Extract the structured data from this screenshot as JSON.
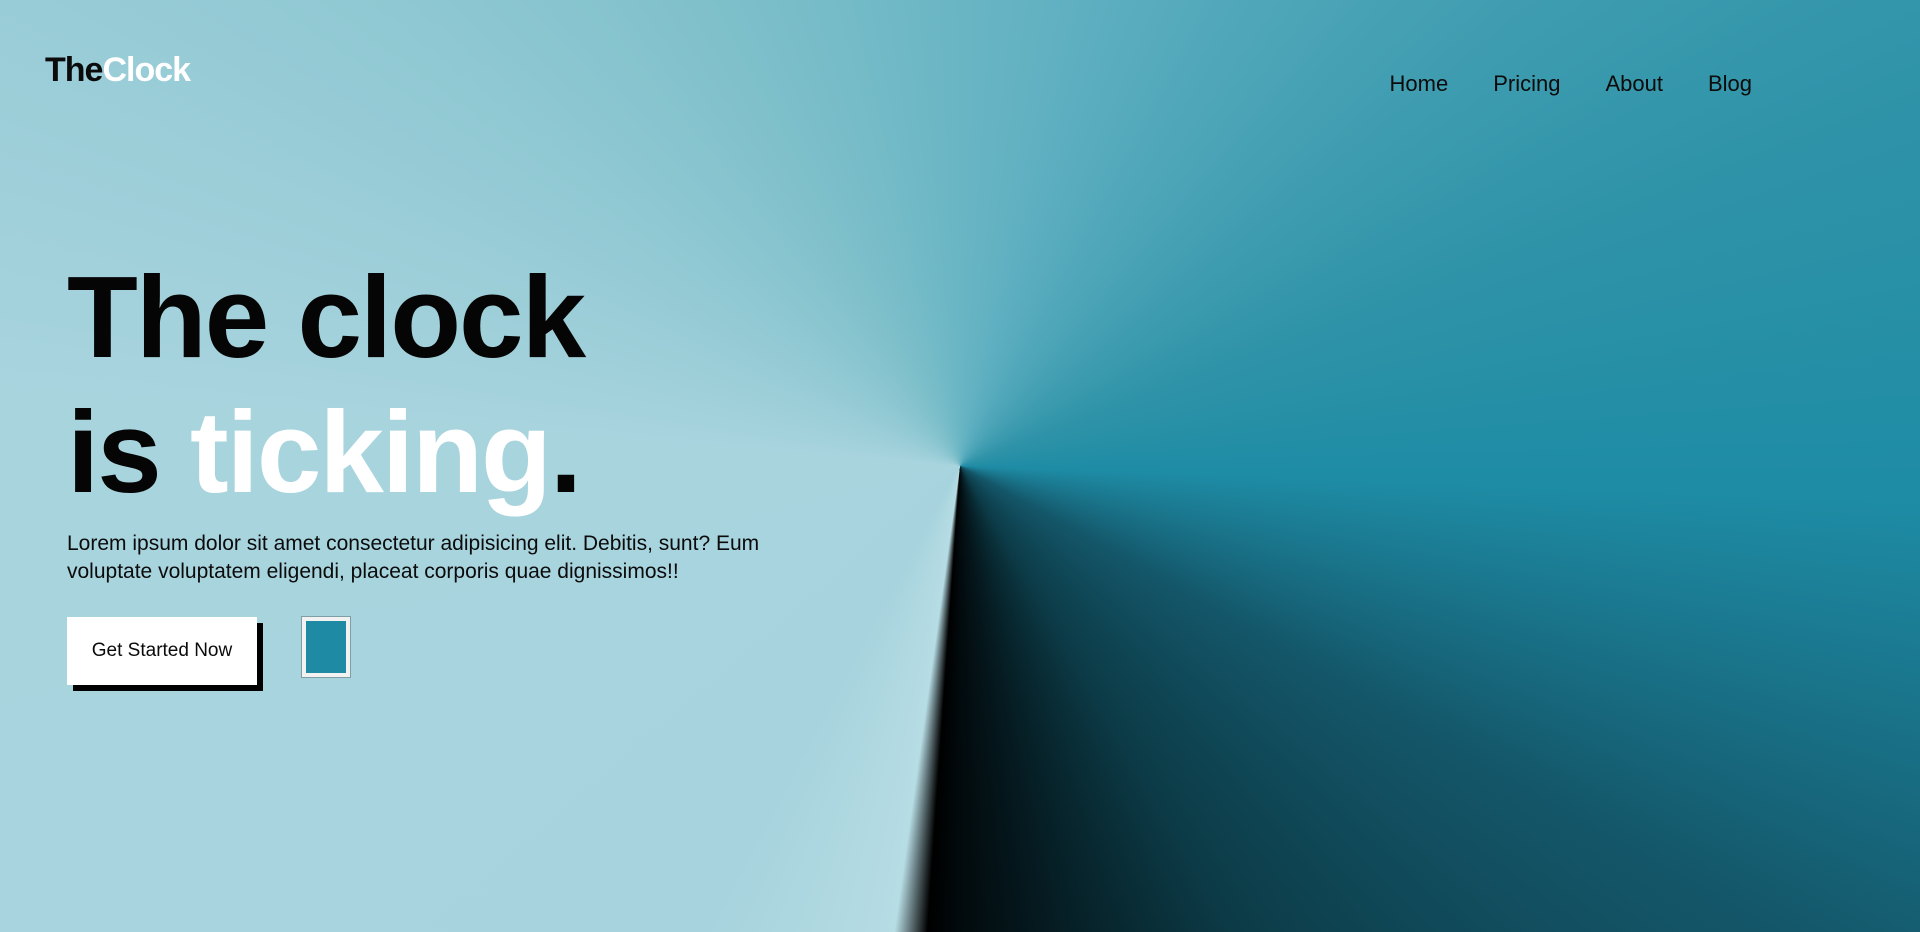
{
  "logo": {
    "part1": "The",
    "part2": "Clock"
  },
  "nav": {
    "items": [
      {
        "label": "Home"
      },
      {
        "label": "Pricing"
      },
      {
        "label": "About"
      },
      {
        "label": "Blog"
      }
    ]
  },
  "hero": {
    "headline_line1": "The clock",
    "headline_is": "is ",
    "headline_ticking": "ticking",
    "headline_dot": ".",
    "description": "Lorem ipsum dolor sit amet consectetur adipisicing elit. Debitis, sunt? Eum voluptate voluptatem eligendi, placeat corporis quae dignissimos!!",
    "cta_label": "Get Started Now"
  },
  "colors": {
    "accent": "#1f8aa3",
    "dark": "#000000",
    "light": "#ffffff"
  }
}
